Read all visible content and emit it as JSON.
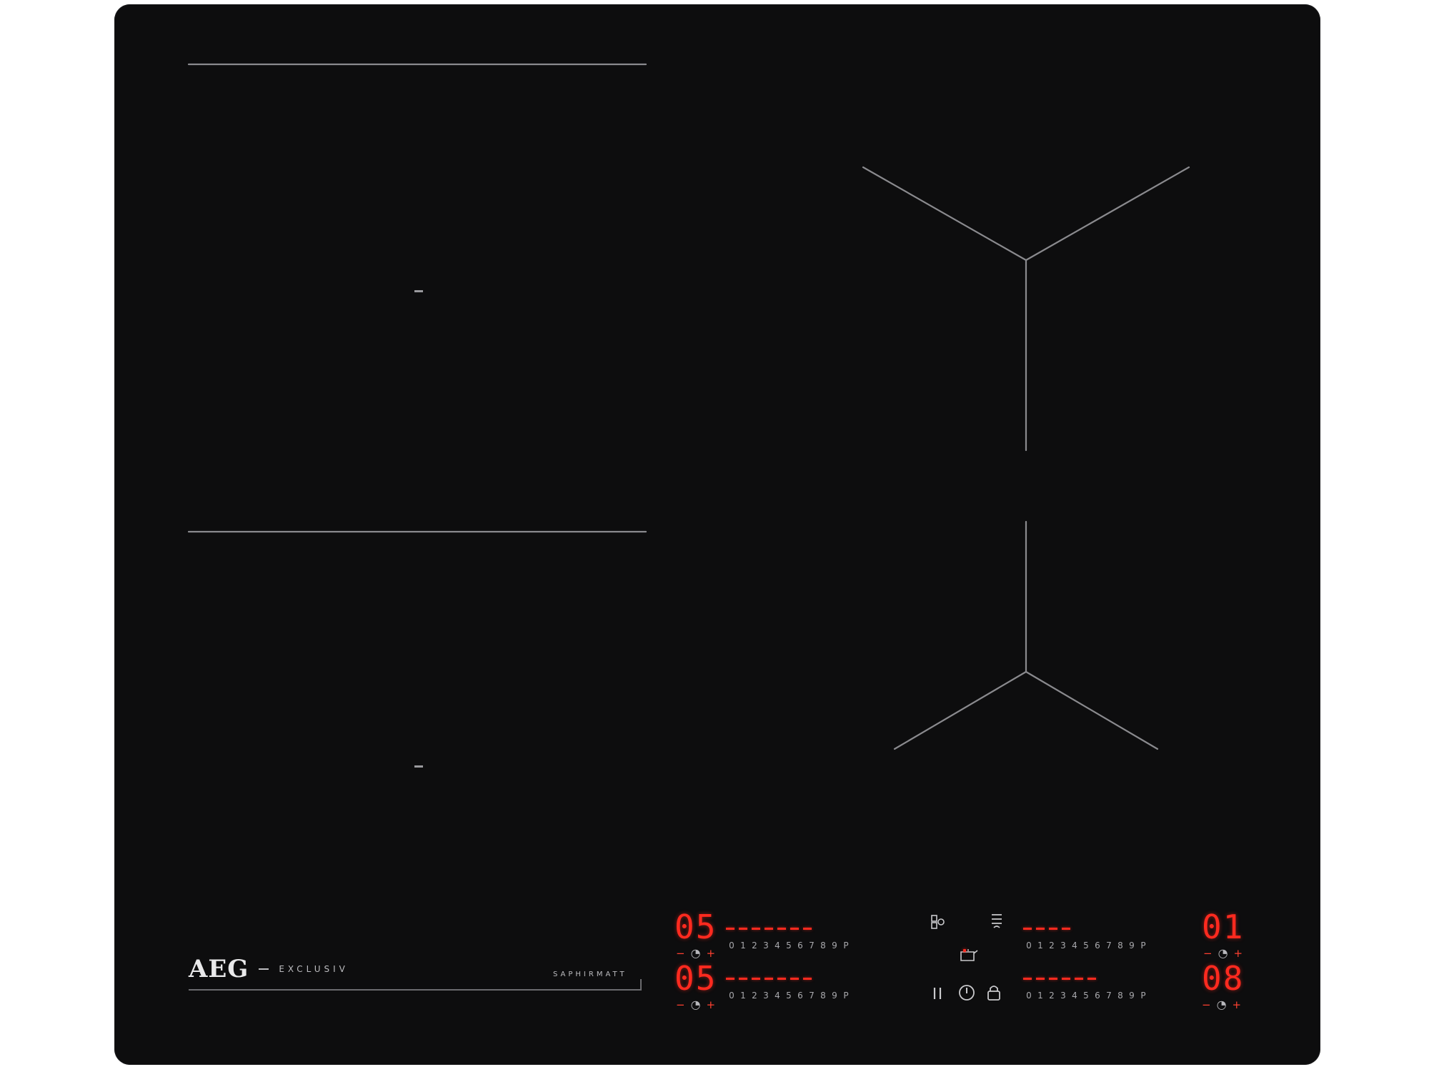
{
  "hob": {
    "brand": "AEG",
    "series": "EXCLUSIV",
    "finish": "SAPHIRMATT"
  },
  "colors": {
    "glass": "#0d0d0e",
    "led": "#ff2a1f",
    "line": "#8a8a8e",
    "print": "#bdbdc0"
  },
  "controls": {
    "zone_top_left": {
      "level": "05",
      "scale": [
        "0",
        "1",
        "2",
        "3",
        "4",
        "5",
        "6",
        "7",
        "8",
        "9",
        "P"
      ],
      "timer_minus": "−",
      "timer_plus": "+"
    },
    "zone_bottom_left": {
      "level": "05",
      "scale": [
        "0",
        "1",
        "2",
        "3",
        "4",
        "5",
        "6",
        "7",
        "8",
        "9",
        "P"
      ],
      "timer_minus": "−",
      "timer_plus": "+"
    },
    "zone_top_right": {
      "level": "01",
      "scale": [
        "0",
        "1",
        "2",
        "3",
        "4",
        "5",
        "6",
        "7",
        "8",
        "9",
        "P"
      ],
      "timer_minus": "−",
      "timer_plus": "+"
    },
    "zone_bottom_right": {
      "level": "08",
      "scale": [
        "0",
        "1",
        "2",
        "3",
        "4",
        "5",
        "6",
        "7",
        "8",
        "9",
        "P"
      ],
      "timer_minus": "−",
      "timer_plus": "+"
    }
  },
  "functions": {
    "pause_icon": "pause-icon",
    "power_icon": "power-icon",
    "lock_icon": "lock-icon",
    "bridge_icon": "bridge-icon",
    "hood_icon": "hob2hood-icon",
    "keep_warm_icon": "keep-warm-icon"
  }
}
